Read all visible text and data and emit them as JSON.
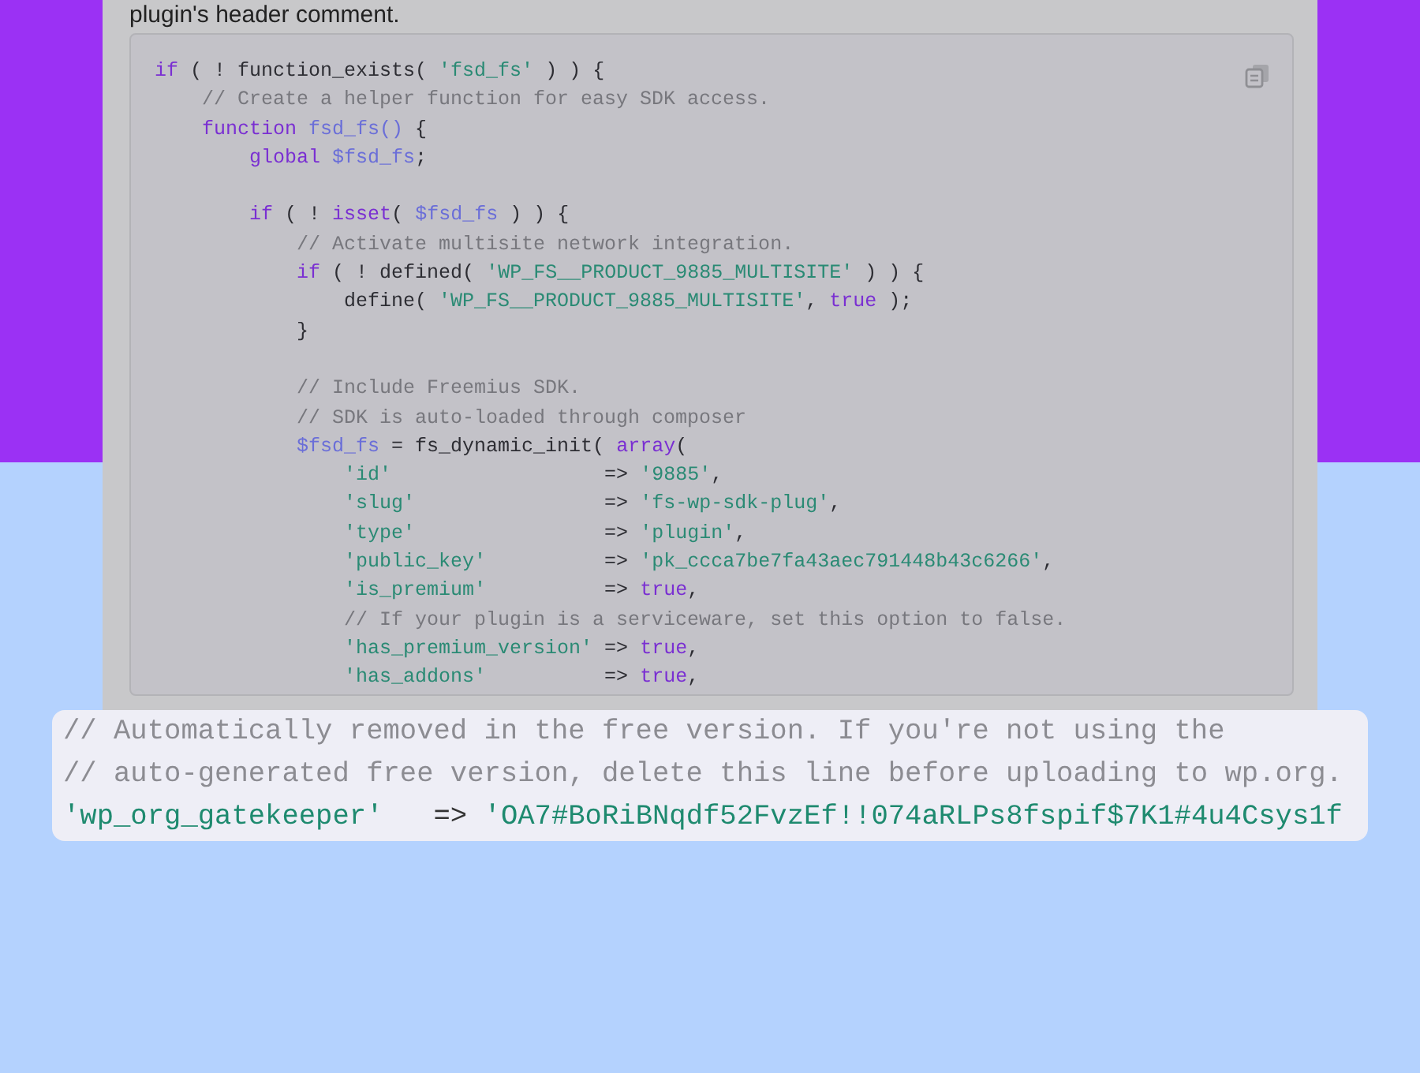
{
  "intro_text": "plugin's header comment.",
  "code_lines": [
    {
      "kind": "code",
      "tokens": [
        {
          "kind": "keyword",
          "text": "if"
        },
        {
          "kind": "plain",
          "text": " ( ! function_exists( "
        },
        {
          "kind": "string",
          "text": "'fsd_fs'"
        },
        {
          "kind": "plain",
          "text": " ) ) {"
        }
      ]
    },
    {
      "kind": "code",
      "tokens": [
        {
          "kind": "comment",
          "text": "    // Create a helper function for easy SDK access."
        }
      ]
    },
    {
      "kind": "code",
      "tokens": [
        {
          "kind": "keyword",
          "text": "    function"
        },
        {
          "kind": "variable",
          "text": " fsd_fs()"
        },
        {
          "kind": "plain",
          "text": " {"
        }
      ]
    },
    {
      "kind": "code",
      "tokens": [
        {
          "kind": "keyword",
          "text": "        global"
        },
        {
          "kind": "variable",
          "text": " $fsd_fs"
        },
        {
          "kind": "plain",
          "text": ";"
        }
      ]
    },
    {
      "kind": "blank"
    },
    {
      "kind": "code",
      "tokens": [
        {
          "kind": "keyword",
          "text": "        if"
        },
        {
          "kind": "plain",
          "text": " ( ! "
        },
        {
          "kind": "keyword",
          "text": "isset"
        },
        {
          "kind": "plain",
          "text": "( "
        },
        {
          "kind": "variable",
          "text": "$fsd_fs"
        },
        {
          "kind": "plain",
          "text": " ) ) {"
        }
      ]
    },
    {
      "kind": "code",
      "tokens": [
        {
          "kind": "comment",
          "text": "            // Activate multisite network integration."
        }
      ]
    },
    {
      "kind": "code",
      "tokens": [
        {
          "kind": "keyword",
          "text": "            if"
        },
        {
          "kind": "plain",
          "text": " ( ! defined( "
        },
        {
          "kind": "string",
          "text": "'WP_FS__PRODUCT_9885_MULTISITE'"
        },
        {
          "kind": "plain",
          "text": " ) ) {"
        }
      ]
    },
    {
      "kind": "code",
      "tokens": [
        {
          "kind": "plain",
          "text": "                define( "
        },
        {
          "kind": "string",
          "text": "'WP_FS__PRODUCT_9885_MULTISITE'"
        },
        {
          "kind": "plain",
          "text": ", "
        },
        {
          "kind": "keyword",
          "text": "true"
        },
        {
          "kind": "plain",
          "text": " );"
        }
      ]
    },
    {
      "kind": "code",
      "tokens": [
        {
          "kind": "plain",
          "text": "            }"
        }
      ]
    },
    {
      "kind": "blank"
    },
    {
      "kind": "code",
      "tokens": [
        {
          "kind": "comment",
          "text": "            // Include Freemius SDK."
        }
      ]
    },
    {
      "kind": "code",
      "tokens": [
        {
          "kind": "comment",
          "text": "            // SDK is auto-loaded through composer"
        }
      ]
    },
    {
      "kind": "code",
      "tokens": [
        {
          "kind": "variable",
          "text": "            $fsd_fs"
        },
        {
          "kind": "plain",
          "text": " = fs_dynamic_init( "
        },
        {
          "kind": "keyword",
          "text": "array"
        },
        {
          "kind": "plain",
          "text": "("
        }
      ]
    },
    {
      "kind": "code",
      "tokens": [
        {
          "kind": "string",
          "text": "                'id'                  "
        },
        {
          "kind": "plain",
          "text": "=> "
        },
        {
          "kind": "string",
          "text": "'9885'"
        },
        {
          "kind": "plain",
          "text": ","
        }
      ]
    },
    {
      "kind": "code",
      "tokens": [
        {
          "kind": "string",
          "text": "                'slug'                "
        },
        {
          "kind": "plain",
          "text": "=> "
        },
        {
          "kind": "string",
          "text": "'fs-wp-sdk-plug'"
        },
        {
          "kind": "plain",
          "text": ","
        }
      ]
    },
    {
      "kind": "code",
      "tokens": [
        {
          "kind": "string",
          "text": "                'type'                "
        },
        {
          "kind": "plain",
          "text": "=> "
        },
        {
          "kind": "string",
          "text": "'plugin'"
        },
        {
          "kind": "plain",
          "text": ","
        }
      ]
    },
    {
      "kind": "code",
      "tokens": [
        {
          "kind": "string",
          "text": "                'public_key'          "
        },
        {
          "kind": "plain",
          "text": "=> "
        },
        {
          "kind": "string",
          "text": "'pk_ccca7be7fa43aec791448b43c6266'"
        },
        {
          "kind": "plain",
          "text": ","
        }
      ]
    },
    {
      "kind": "code",
      "tokens": [
        {
          "kind": "string",
          "text": "                'is_premium'          "
        },
        {
          "kind": "plain",
          "text": "=> "
        },
        {
          "kind": "keyword",
          "text": "true"
        },
        {
          "kind": "plain",
          "text": ","
        }
      ]
    },
    {
      "kind": "code",
      "tokens": [
        {
          "kind": "comment",
          "text": "                // If your plugin is a serviceware, set this option to false."
        }
      ]
    },
    {
      "kind": "code",
      "tokens": [
        {
          "kind": "string",
          "text": "                'has_premium_version' "
        },
        {
          "kind": "plain",
          "text": "=> "
        },
        {
          "kind": "keyword",
          "text": "true"
        },
        {
          "kind": "plain",
          "text": ","
        }
      ]
    },
    {
      "kind": "code",
      "tokens": [
        {
          "kind": "string",
          "text": "                'has_addons'          "
        },
        {
          "kind": "plain",
          "text": "=> "
        },
        {
          "kind": "keyword",
          "text": "true"
        },
        {
          "kind": "plain",
          "text": ","
        }
      ]
    }
  ],
  "highlight_lines": [
    {
      "tokens": [
        {
          "kind": "comment",
          "text": "// Automatically removed in the free version. If you're not using the"
        }
      ]
    },
    {
      "tokens": [
        {
          "kind": "comment",
          "text": "// auto-generated free version, delete this line before uploading to wp.org."
        }
      ]
    },
    {
      "tokens": [
        {
          "kind": "string",
          "text": "'wp_org_gatekeeper'"
        },
        {
          "kind": "plain",
          "text": "   => "
        },
        {
          "kind": "string",
          "text": "'OA7#BoRiBNqdf52FvzEf!!074aRLPs8fspif$7K1#4u4Csys1f"
        }
      ]
    }
  ]
}
